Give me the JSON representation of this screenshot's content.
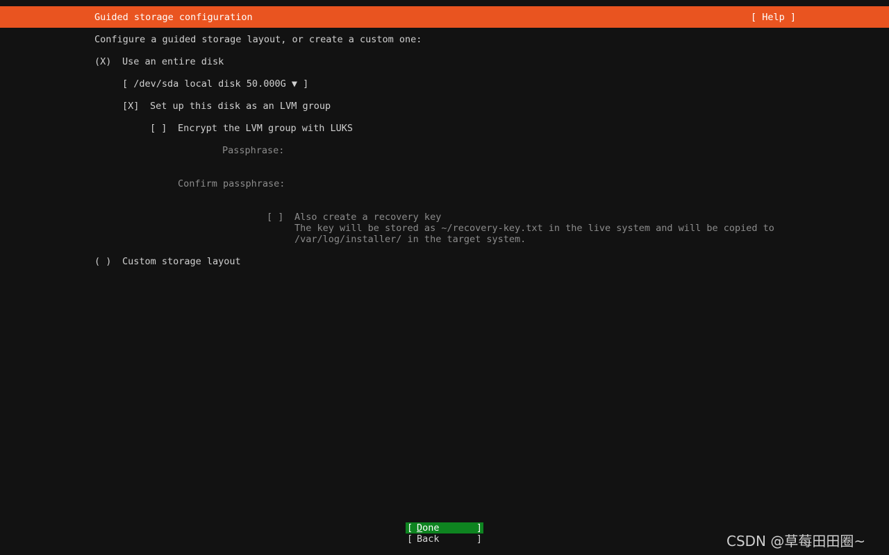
{
  "header": {
    "title": "Guided storage configuration",
    "help": "[ Help ]"
  },
  "intro": "Configure a guided storage layout, or create a custom one:",
  "options": {
    "entire_disk": {
      "marker": "(X)",
      "label": "Use an entire disk"
    },
    "disk_select": {
      "value": "[ /dev/sda local disk 50.000G ▼ ]"
    },
    "lvm": {
      "marker": "[X]",
      "label": "Set up this disk as an LVM group"
    },
    "luks": {
      "marker": "[ ]",
      "label": "Encrypt the LVM group with LUKS"
    },
    "passphrase": {
      "label": "Passphrase:",
      "value": ""
    },
    "confirm_passphrase": {
      "label": "Confirm passphrase:",
      "value": ""
    },
    "recovery": {
      "marker": "[ ]",
      "label": "Also create a recovery key",
      "desc_line1": "The key will be stored as ~/recovery-key.txt in the live system and will be copied to",
      "desc_line2": "/var/log/installer/ in the target system."
    },
    "custom": {
      "marker": "( )",
      "label": "Custom storage layout"
    }
  },
  "buttons": {
    "done": {
      "open": "[",
      "hotkey": "D",
      "rest": "one",
      "close": "]"
    },
    "back": {
      "open": "[",
      "label": "Back",
      "close": "]"
    }
  },
  "watermark": "CSDN @草莓田田圈~",
  "colors": {
    "header_bg": "#e95420",
    "focused_button_bg": "#0e8420",
    "background": "#121212"
  }
}
